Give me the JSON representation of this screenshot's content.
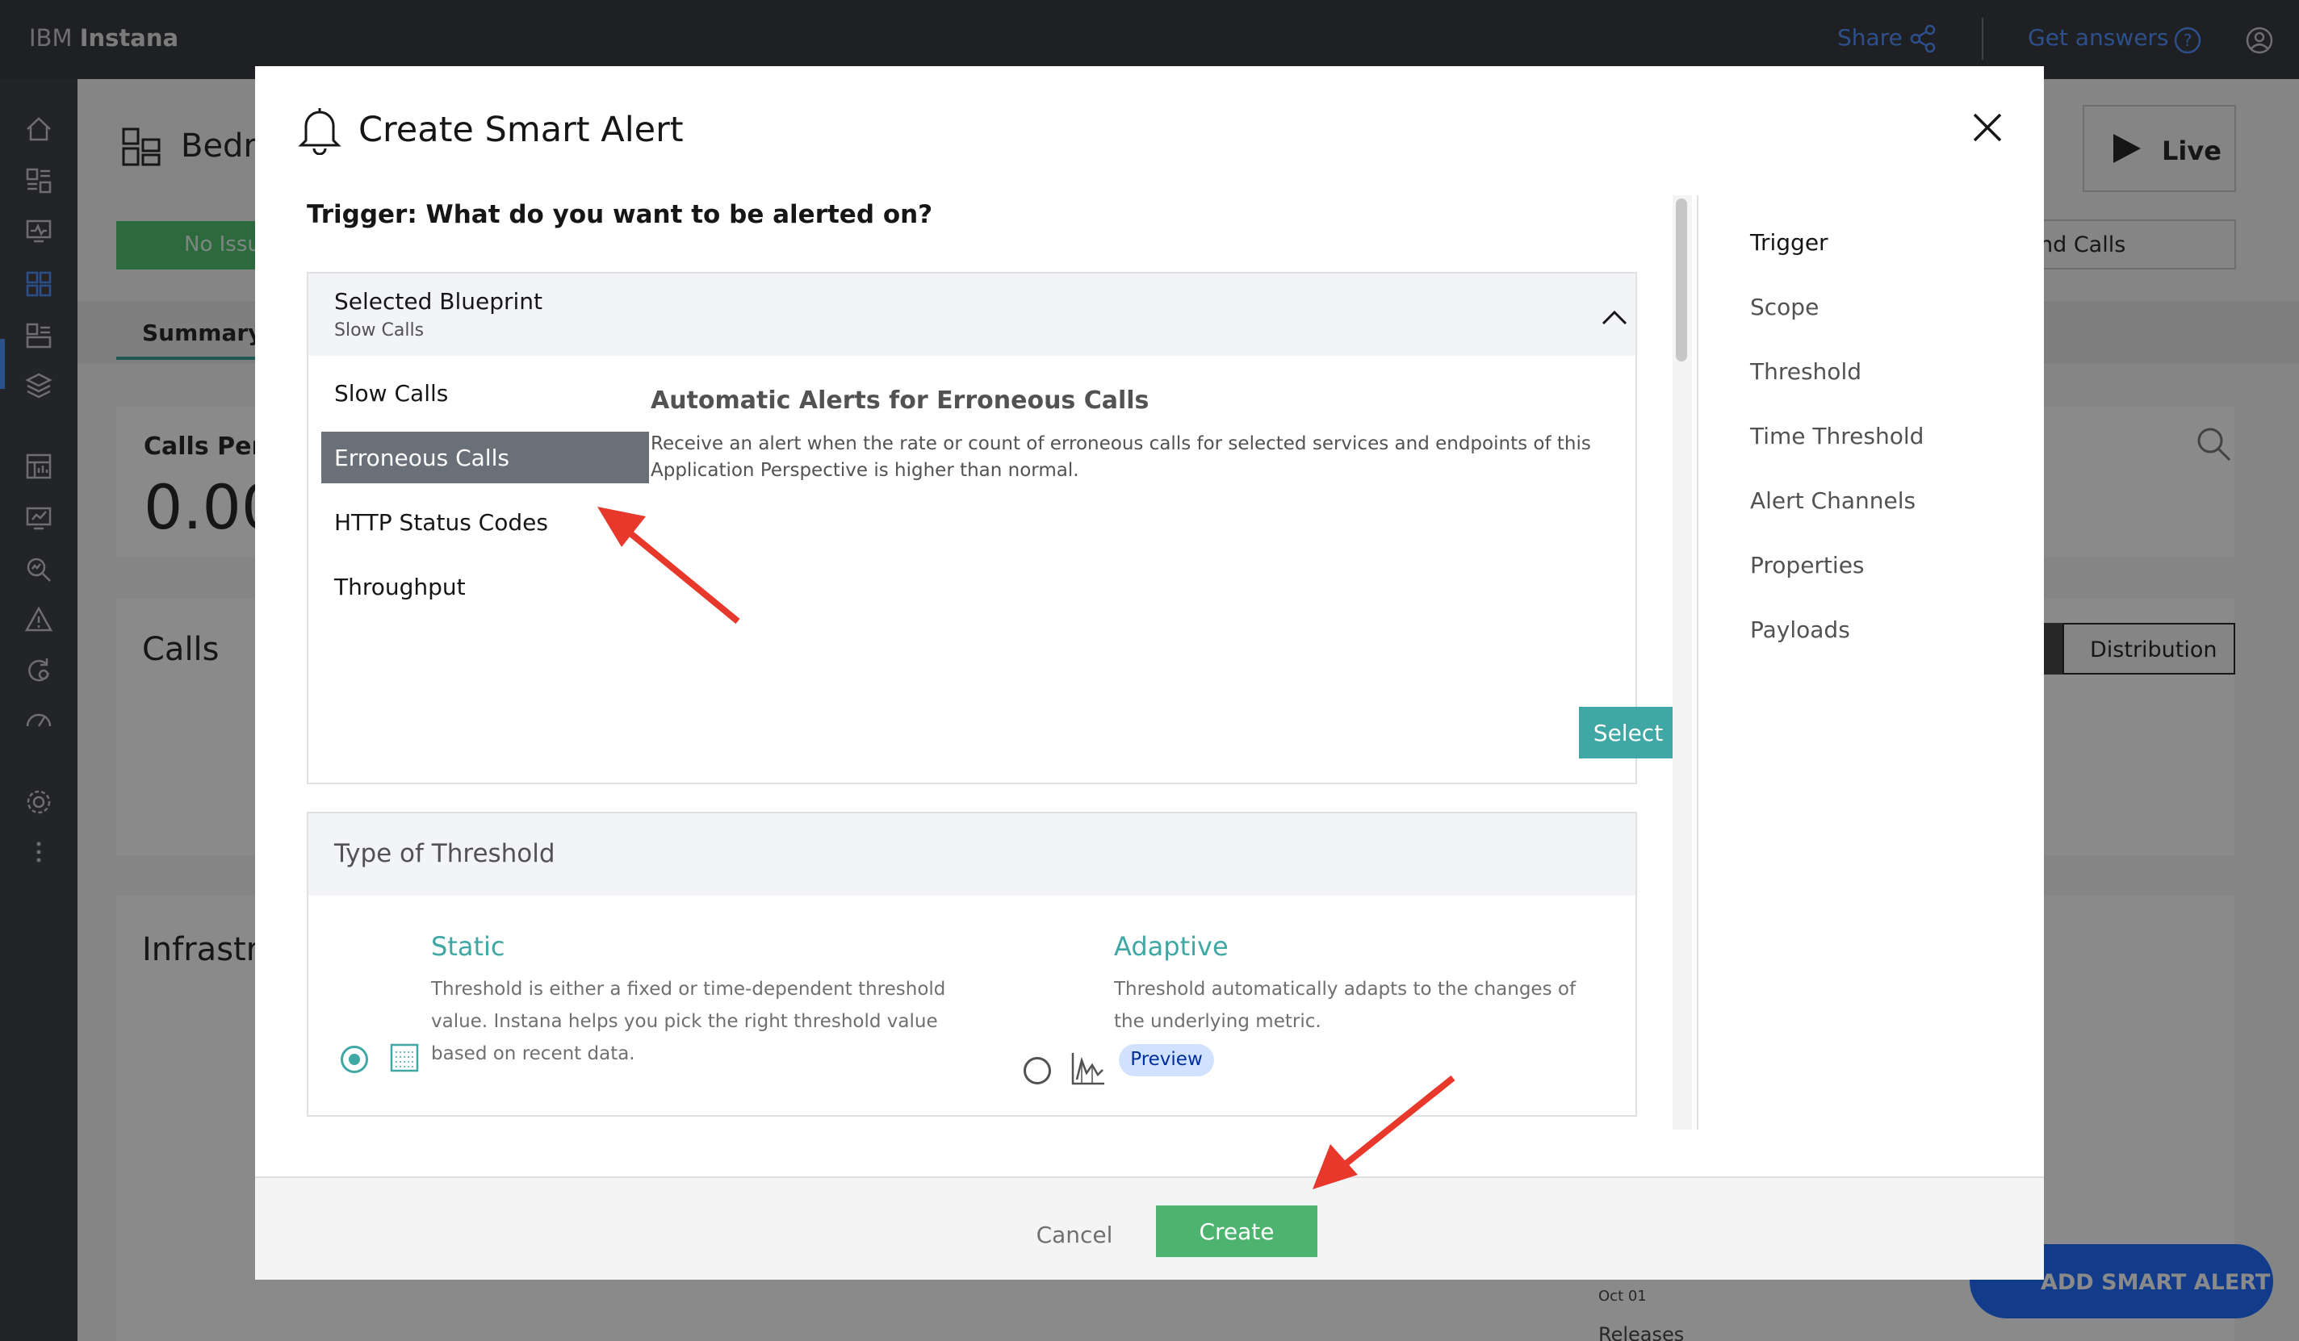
{
  "topbar": {
    "brand_prefix": "IBM",
    "brand_name": "Instana",
    "share": "Share",
    "get_answers": "Get answers"
  },
  "background": {
    "title": "Bedr",
    "no_issues": "No Issu",
    "summary_tab": "Summary",
    "calls_per": "Calls Per",
    "value": "0.00",
    "calls": "Calls",
    "infrastructure": "Infrastr",
    "live": "Live",
    "calls_dropdown": "nd Calls",
    "distribution": "Distribution",
    "add_smart_alert": "ADD SMART ALERT",
    "date": "Oct 01",
    "releases": "Releases"
  },
  "modal": {
    "title": "Create Smart Alert",
    "trigger_question": "Trigger: What do you want to be alerted on?",
    "blueprint": {
      "header_title": "Selected Blueprint",
      "header_sub": "Slow Calls",
      "items": [
        "Slow Calls",
        "Erroneous Calls",
        "HTTP Status Codes",
        "Throughput"
      ],
      "selected_index": 1,
      "desc_title": "Automatic Alerts for Erroneous Calls",
      "desc_text": "Receive an alert when the rate or count of erroneous calls for selected services and endpoints of this Application Perspective is higher than normal.",
      "select_label": "Select"
    },
    "threshold": {
      "header": "Type of Threshold",
      "static_title": "Static",
      "static_text": "Threshold is either a fixed or time-dependent threshold value. Instana helps you pick the right threshold value based on recent data.",
      "adaptive_title": "Adaptive",
      "adaptive_text": "Threshold automatically adapts to the changes of the underlying metric.",
      "preview": "Preview",
      "selected": "Static"
    },
    "steps": [
      "Trigger",
      "Scope",
      "Threshold",
      "Time Threshold",
      "Alert Channels",
      "Properties",
      "Payloads"
    ],
    "active_step": "Trigger",
    "cancel": "Cancel",
    "create": "Create"
  },
  "colors": {
    "accent_teal": "#3fa7a4",
    "create_green": "#4cb46e",
    "annotation_red": "#e8382b",
    "topbar_bg": "#262a31"
  }
}
